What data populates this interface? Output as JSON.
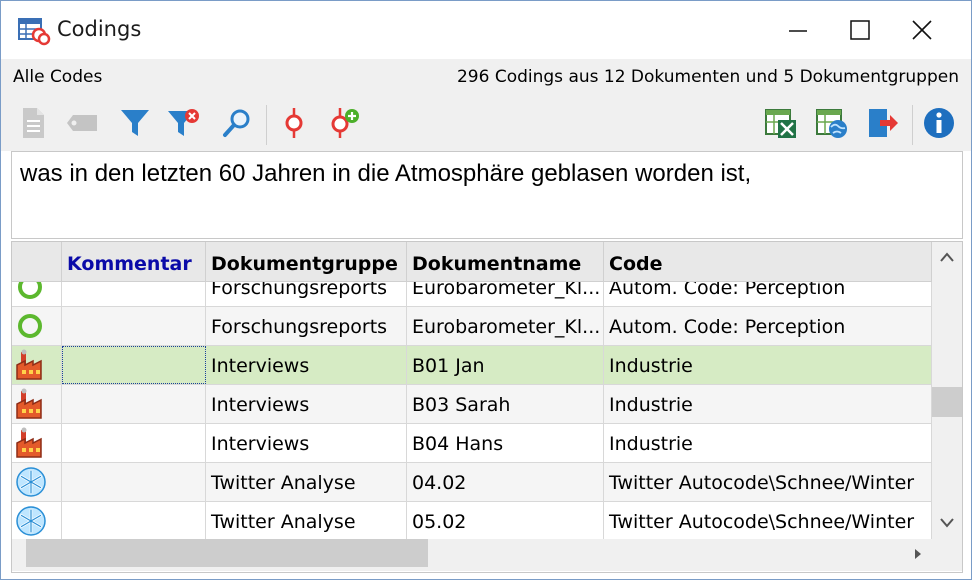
{
  "window": {
    "title": "Codings",
    "app_icon": "codings-table-icon",
    "controls": [
      "minimize-icon",
      "maximize-icon",
      "close-icon"
    ]
  },
  "infobar": {
    "left": "Alle Codes",
    "right": "296 Codings aus 12 Dokumenten und 5 Dokumentgruppen"
  },
  "toolbar": {
    "left_icons": [
      "document-icon",
      "tag-icon",
      "filter-icon",
      "filter-clear-icon",
      "search-icon",
      "code-icon",
      "code-add-icon"
    ],
    "right_icons": [
      "excel-export-icon",
      "html-export-icon",
      "export-icon",
      "info-icon"
    ]
  },
  "text_panel": {
    "text": "was in den letzten 60 Jahren in die Atmosphäre geblasen worden ist,"
  },
  "table": {
    "headers": {
      "kommentar": "Kommentar",
      "dokumentgruppe": "Dokumentgruppe",
      "dokumentname": "Dokumentname",
      "code": "Code"
    },
    "rows": [
      {
        "icon": "circle-icon",
        "kommentar": "",
        "dokumentgruppe": "Forschungsreports",
        "dokumentname": "Eurobarometer_Kl...",
        "code": "Autom. Code: Perception"
      },
      {
        "icon": "circle-icon",
        "kommentar": "",
        "dokumentgruppe": "Forschungsreports",
        "dokumentname": "Eurobarometer_Kl...",
        "code": "Autom. Code: Perception"
      },
      {
        "icon": "factory-icon",
        "kommentar": "",
        "dokumentgruppe": "Interviews",
        "dokumentname": "B01 Jan",
        "code": "Industrie"
      },
      {
        "icon": "factory-icon",
        "kommentar": "",
        "dokumentgruppe": "Interviews",
        "dokumentname": "B03 Sarah",
        "code": "Industrie"
      },
      {
        "icon": "factory-icon",
        "kommentar": "",
        "dokumentgruppe": "Interviews",
        "dokumentname": "B04 Hans",
        "code": "Industrie"
      },
      {
        "icon": "snowflake-icon",
        "kommentar": "",
        "dokumentgruppe": "Twitter Analyse",
        "dokumentname": "04.02",
        "code": "Twitter Autocode\\Schnee/Winter"
      },
      {
        "icon": "snowflake-icon",
        "kommentar": "",
        "dokumentgruppe": "Twitter Analyse",
        "dokumentname": "05.02",
        "code": "Twitter Autocode\\Schnee/Winter"
      }
    ]
  },
  "colors": {
    "selected_row": "#d6ebc4",
    "header_link": "#0a0aa8",
    "accent_blue": "#1e88d2",
    "code_red": "#e53935",
    "circle_green": "#5cb82e"
  }
}
